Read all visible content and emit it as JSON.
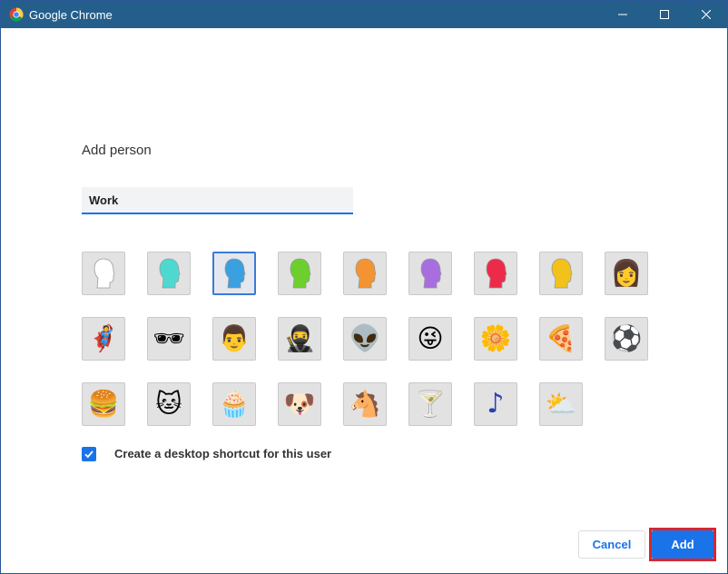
{
  "window": {
    "title": "Google Chrome",
    "accent_color": "#245f8c"
  },
  "dialog": {
    "heading": "Add person",
    "name_input": {
      "value": "Work",
      "placeholder": ""
    },
    "shortcut_checkbox": {
      "label": "Create a desktop shortcut for this user",
      "checked": true
    },
    "buttons": {
      "cancel": "Cancel",
      "add": "Add"
    }
  },
  "avatars": [
    {
      "name": "generic-white-avatar",
      "color": "#ffffff",
      "selected": false
    },
    {
      "name": "generic-teal-avatar",
      "color": "#4dd9d0",
      "selected": false
    },
    {
      "name": "generic-blue-avatar",
      "color": "#3aa0e0",
      "selected": true
    },
    {
      "name": "generic-green-avatar",
      "color": "#6ccf2e",
      "selected": false
    },
    {
      "name": "generic-orange-avatar",
      "color": "#f39332",
      "selected": false
    },
    {
      "name": "generic-purple-avatar",
      "color": "#a86ee0",
      "selected": false
    },
    {
      "name": "generic-red-avatar",
      "color": "#ec2b4a",
      "selected": false
    },
    {
      "name": "generic-yellow-avatar",
      "color": "#f2c21a",
      "selected": false
    },
    {
      "name": "businesswoman-avatar",
      "glyph": "👩",
      "selected": false
    },
    {
      "name": "superhero-avatar",
      "glyph": "🦸",
      "selected": false
    },
    {
      "name": "sunglasses-woman-avatar",
      "glyph": "🕶",
      "selected": false
    },
    {
      "name": "businessman-avatar",
      "glyph": "👨",
      "selected": false
    },
    {
      "name": "ninja-avatar",
      "glyph": "🥷",
      "selected": false
    },
    {
      "name": "alien-avatar",
      "glyph": "👽",
      "selected": false
    },
    {
      "name": "smiley-avatar",
      "glyph": "😜",
      "selected": false
    },
    {
      "name": "flower-avatar",
      "glyph": "🌼",
      "selected": false
    },
    {
      "name": "pizza-avatar",
      "glyph": "🍕",
      "selected": false
    },
    {
      "name": "soccer-ball-avatar",
      "glyph": "⚽",
      "selected": false
    },
    {
      "name": "burger-avatar",
      "glyph": "🍔",
      "selected": false
    },
    {
      "name": "cat-avatar",
      "glyph": "🐱",
      "selected": false
    },
    {
      "name": "cupcake-avatar",
      "glyph": "🧁",
      "selected": false
    },
    {
      "name": "dog-avatar",
      "glyph": "🐶",
      "selected": false
    },
    {
      "name": "horse-avatar",
      "glyph": "🐴",
      "selected": false
    },
    {
      "name": "cocktail-avatar",
      "glyph": "🍸",
      "selected": false
    },
    {
      "name": "music-note-avatar",
      "glyph": "♪",
      "selected": false
    },
    {
      "name": "sun-cloud-avatar",
      "glyph": "⛅",
      "selected": false
    }
  ]
}
